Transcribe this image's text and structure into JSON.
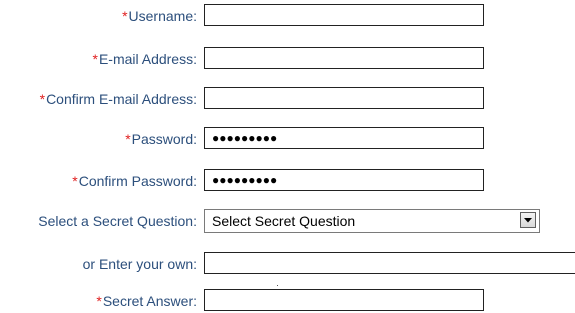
{
  "required_marker": "*",
  "form": {
    "username": {
      "label": "Username:",
      "value": ""
    },
    "email": {
      "label": "E-mail Address:",
      "value": ""
    },
    "confirm_email": {
      "label": "Confirm E-mail Address:",
      "value": ""
    },
    "password": {
      "label": "Password:",
      "value": "●●●●●●●●●"
    },
    "confirm_password": {
      "label": "Confirm Password:",
      "value": "●●●●●●●●●"
    },
    "secret_question": {
      "label": "Select a Secret Question:",
      "selected": "Select Secret Question",
      "icon": "chevron-down-icon"
    },
    "own_question": {
      "label": "or Enter your own:",
      "value": ""
    },
    "secret_answer": {
      "label": "Secret Answer:",
      "value": ""
    }
  },
  "colors": {
    "label": "#2c4f7c",
    "required": "#e02020",
    "border": "#222222"
  }
}
